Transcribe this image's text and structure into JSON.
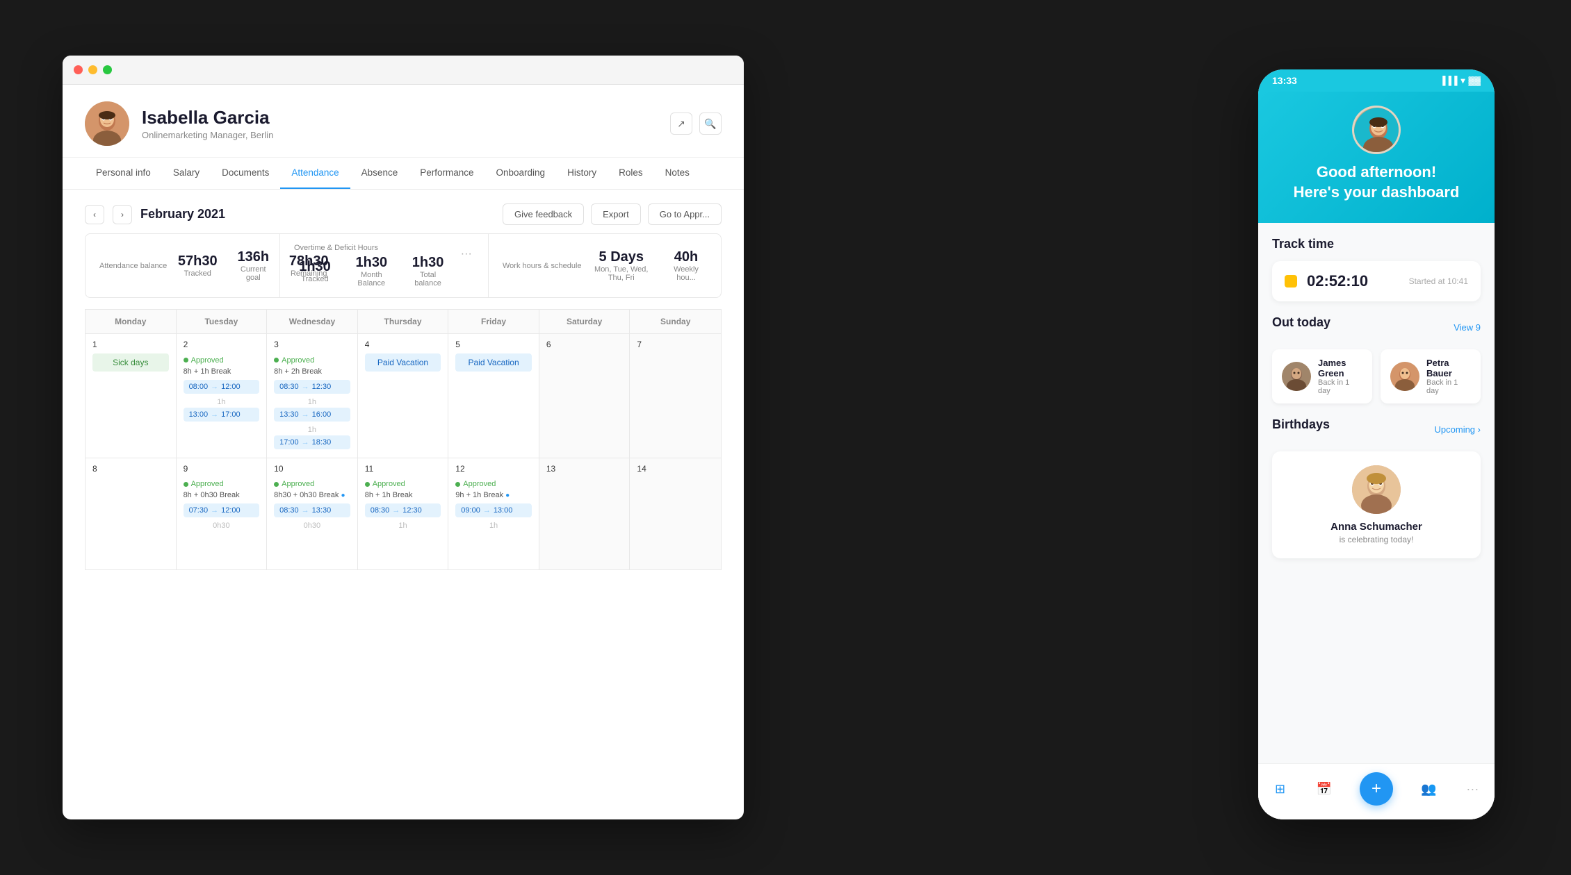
{
  "desktop": {
    "person": {
      "name": "Isabella Garcia",
      "title": "Onlinemarketing Manager, Berlin"
    },
    "nav_tabs": [
      {
        "label": "Personal info",
        "active": false
      },
      {
        "label": "Salary",
        "active": false
      },
      {
        "label": "Documents",
        "active": false
      },
      {
        "label": "Attendance",
        "active": true
      },
      {
        "label": "Absence",
        "active": false
      },
      {
        "label": "Performance",
        "active": false
      },
      {
        "label": "Onboarding",
        "active": false
      },
      {
        "label": "History",
        "active": false
      },
      {
        "label": "Roles",
        "active": false
      },
      {
        "label": "Notes",
        "active": false
      }
    ],
    "calendar": {
      "month": "February 2021",
      "give_feedback": "Give feedback",
      "export": "Export",
      "go_to_appr": "Go to Appr...",
      "days": [
        "Monday",
        "Tuesday",
        "Wednesday",
        "Thursday",
        "Friday",
        "Saturday",
        "Sunday"
      ]
    },
    "stats": {
      "attendance_balance_label": "Attendance balance",
      "tracked_value": "57h30",
      "tracked_label": "Tracked",
      "goal_value": "136h",
      "goal_label": "Current goal",
      "remaining_value": "78h30",
      "remaining_label": "Remaining",
      "overtime_label": "Overtime & Deficit Hours",
      "ot_tracked_value": "1h30",
      "ot_tracked_label": "Tracked",
      "ot_month_value": "1h30",
      "ot_month_label": "Month Balance",
      "ot_total_value": "1h30",
      "ot_total_label": "Total balance",
      "work_hours_label": "Work hours & schedule",
      "days_value": "5 Days",
      "days_label": "Mon, Tue, Wed, Thu, Fri",
      "weekly_value": "40h",
      "weekly_label": "Weekly hou..."
    }
  },
  "mobile": {
    "time": "13:33",
    "greeting_line1": "Good afternoon!",
    "greeting_line2": "Here's your dashboard",
    "track_time_title": "Track time",
    "track_time_value": "02:52:10",
    "track_started": "Started at 10:41",
    "out_today_title": "Out today",
    "view_label": "View",
    "view_count": "9",
    "person1_name": "James Green",
    "person1_status": "Back in 1 day",
    "person2_name": "Petra Bauer",
    "person2_status": "Back in 1 day",
    "birthdays_title": "Birthdays",
    "upcoming_label": "Upcoming",
    "birthday_name": "Anna Schumacher",
    "birthday_sub": "is celebrating today!"
  }
}
